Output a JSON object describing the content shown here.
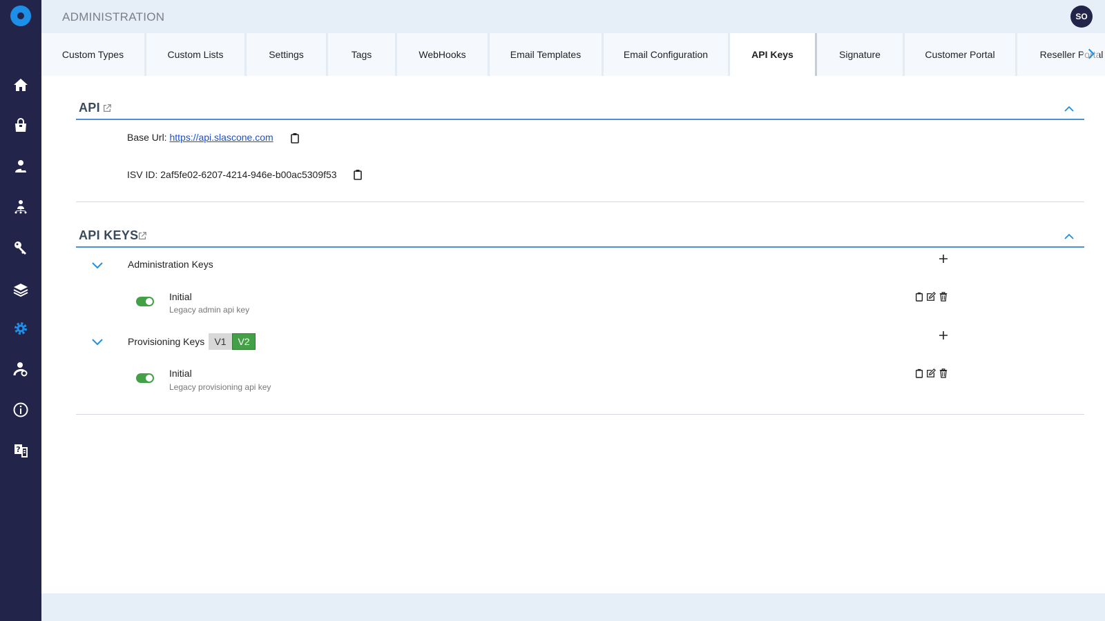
{
  "header": {
    "title": "ADMINISTRATION",
    "avatar_initials": "SO"
  },
  "sidebar": {
    "items": [
      {
        "icon": "home-icon"
      },
      {
        "icon": "shopping-bag-icon"
      },
      {
        "icon": "customer-icon"
      },
      {
        "icon": "users-network-icon"
      },
      {
        "icon": "key-icon"
      },
      {
        "icon": "layers-icon"
      },
      {
        "icon": "gear-icon",
        "active": true
      },
      {
        "icon": "user-settings-icon"
      },
      {
        "icon": "info-icon"
      },
      {
        "icon": "help-docs-icon"
      }
    ],
    "active_color": "#1e8fe6"
  },
  "tabs": [
    {
      "label": "Custom Types"
    },
    {
      "label": "Custom Lists"
    },
    {
      "label": "Settings"
    },
    {
      "label": "Tags"
    },
    {
      "label": "WebHooks"
    },
    {
      "label": "Email Templates"
    },
    {
      "label": "Email Configuration"
    },
    {
      "label": "API Keys",
      "active": true
    },
    {
      "label": "Signature"
    },
    {
      "label": "Customer Portal"
    },
    {
      "label": "Reseller Portal"
    }
  ],
  "api_section": {
    "title": "API",
    "base_url_label": "Base Url:",
    "base_url_value": "https://api.slascone.com",
    "isv_label": "ISV ID:",
    "isv_value": "2af5fe02-6207-4214-946e-b00ac5309f53"
  },
  "api_keys_section": {
    "title": "API KEYS",
    "groups": [
      {
        "label": "Administration Keys",
        "keys": [
          {
            "name": "Initial",
            "description": "Legacy admin api key",
            "enabled": true
          }
        ]
      },
      {
        "label": "Provisioning Keys",
        "versions": [
          "V1",
          "V2"
        ],
        "active_version": "V2",
        "keys": [
          {
            "name": "Initial",
            "description": "Legacy provisioning api key",
            "enabled": true
          }
        ]
      }
    ]
  },
  "colors": {
    "sidebar": "#23244a",
    "accent": "#1e8fe6",
    "toggle_on": "#43a047",
    "link": "#1a4fd6"
  }
}
